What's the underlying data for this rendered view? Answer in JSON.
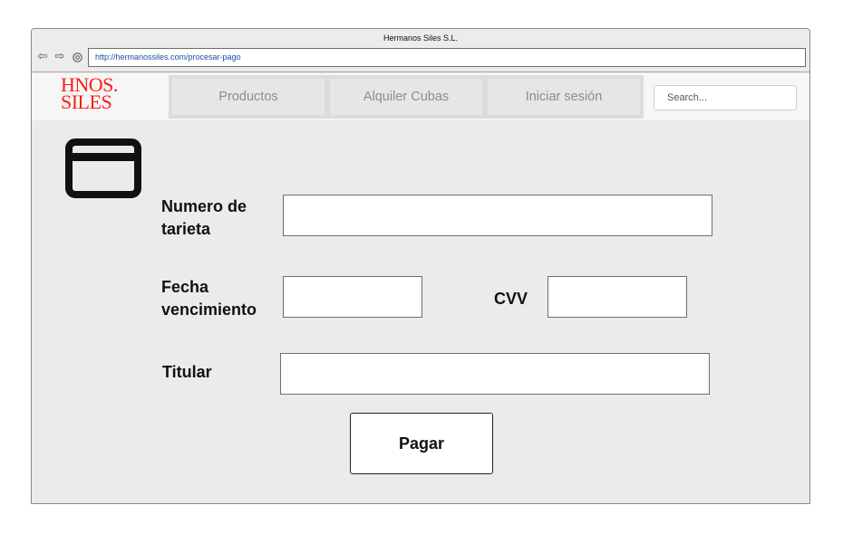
{
  "window": {
    "title": "Hermanos Siles S.L.",
    "url": "http://hermanossiles.com/procesar-pago"
  },
  "toolbar": {
    "back_icon": "back-arrow-icon",
    "forward_icon": "forward-arrow-icon",
    "reload_icon": "reload-icon"
  },
  "header": {
    "logo_line1": "HNOS.",
    "logo_line2": "SILES",
    "logo_color": "#ff1a1a",
    "nav": [
      {
        "label": "Productos"
      },
      {
        "label": "Alquiler Cubas"
      },
      {
        "label": "Iniciar sesión"
      }
    ],
    "search": {
      "placeholder": "Search...",
      "value": ""
    }
  },
  "payment_form": {
    "icon": "credit-card-icon",
    "card_number_label": "Numero de tarieta",
    "card_number_value": "",
    "expiry_label": "Fecha vencimiento",
    "expiry_value": "",
    "cvv_label": "CVV",
    "cvv_value": "",
    "holder_label": "Titular",
    "holder_value": "",
    "submit_label": "Pagar"
  }
}
